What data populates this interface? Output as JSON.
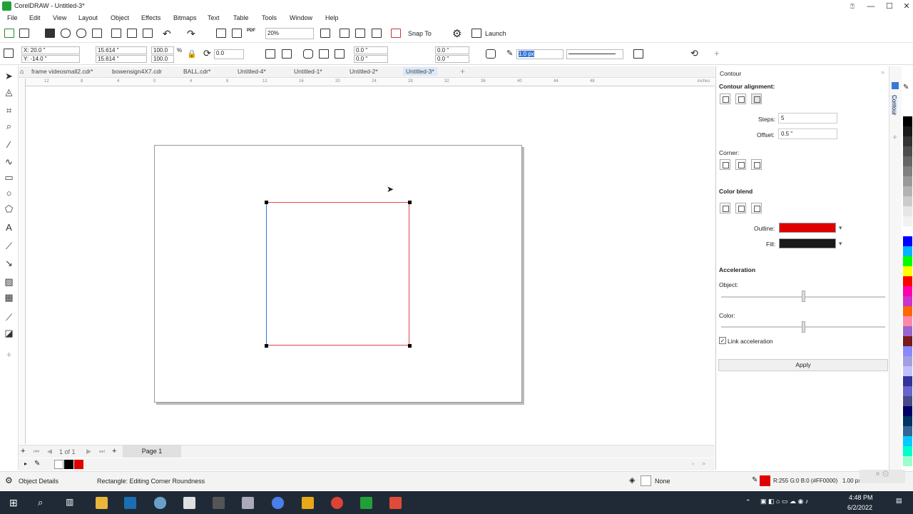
{
  "window": {
    "title": "CorelDRAW - Untitled-3*",
    "controls": [
      "—",
      "☐",
      "✕"
    ]
  },
  "menu": [
    "File",
    "Edit",
    "View",
    "Layout",
    "Object",
    "Effects",
    "Bitmaps",
    "Text",
    "Table",
    "Tools",
    "Window",
    "Help"
  ],
  "toolbar": {
    "zoom": "20%",
    "snap_to": "Snap To",
    "launch": "Launch",
    "pdf": "PDF"
  },
  "propbar": {
    "x": "X: 20.0 \"",
    "y": "Y: -14.0 \"",
    "w": "15.614 \"",
    "h": "15.614 \"",
    "sx": "100.0",
    "sy": "100.0",
    "pct": "%",
    "rot": "0.0",
    "c1": "0.0 \"",
    "c2": "0.0 \"",
    "c3": "0.0 \"",
    "c4": "0.0 \"",
    "outline_width": "1.0 px"
  },
  "tabs": [
    {
      "label": "frame videosmall2.cdr*"
    },
    {
      "label": "bowensign4X7.cdr"
    },
    {
      "label": "BALL.cdr*"
    },
    {
      "label": "Untitled-4*"
    },
    {
      "label": "Untitled-1*"
    },
    {
      "label": "Untitled-2*"
    },
    {
      "label": "Untitled-3*"
    }
  ],
  "ruler": {
    "ticks": [
      "12",
      "8",
      "4",
      "0",
      "4",
      "8",
      "12",
      "16",
      "20",
      "24",
      "28",
      "32",
      "36",
      "40",
      "44",
      "48"
    ],
    "units": "inches"
  },
  "pagenav": {
    "of": "1 of 1",
    "page": "Page 1"
  },
  "status": {
    "object_details": "Object Details",
    "message": "Rectangle: Editing Corner Roundness",
    "fill": "None",
    "color": "R:255 G:0 B:0 (#FF0000)",
    "width": "1.00 px"
  },
  "panel": {
    "title": "Contour",
    "side_tab": "Contour",
    "alignment": "Contour alignment:",
    "steps_label": "Steps:",
    "steps": "5",
    "offset_label": "Offset:",
    "offset": "0.5 \"",
    "corner": "Corner:",
    "color_blend": "Color blend",
    "outline_label": "Outline:",
    "fill_label": "Fill:",
    "outline_color": "#e00000",
    "fill_color": "#1a1a1a",
    "acceleration": "Acceleration",
    "object_label": "Object:",
    "color_label": "Color:",
    "object_accel": 0.5,
    "color_accel": 0.5,
    "link": "Link acceleration",
    "apply": "Apply"
  },
  "palette": [
    "#ffffff",
    "#000000",
    "#1a1a1a",
    "#333333",
    "#4d4d4d",
    "#666666",
    "#808080",
    "#999999",
    "#b3b3b3",
    "#cccccc",
    "#e6e6e6",
    "#f2f2f2",
    "#ffffff",
    "#0000ff",
    "#00b4ff",
    "#00ff00",
    "#ffff00",
    "#ff0000",
    "#ff00aa",
    "#cc33cc",
    "#ff6600",
    "#ff88aa",
    "#9966cc",
    "#7a1a1a",
    "#8888ff",
    "#a0a0e0",
    "#c0c0ff",
    "#333399",
    "#6666cc",
    "#4a4a8a",
    "#000066",
    "#003366",
    "#336699",
    "#00ccff",
    "#00ffcc",
    "#99ffcc"
  ],
  "taskbar": {
    "time": "4:48 PM",
    "date": "6/2/2022"
  }
}
